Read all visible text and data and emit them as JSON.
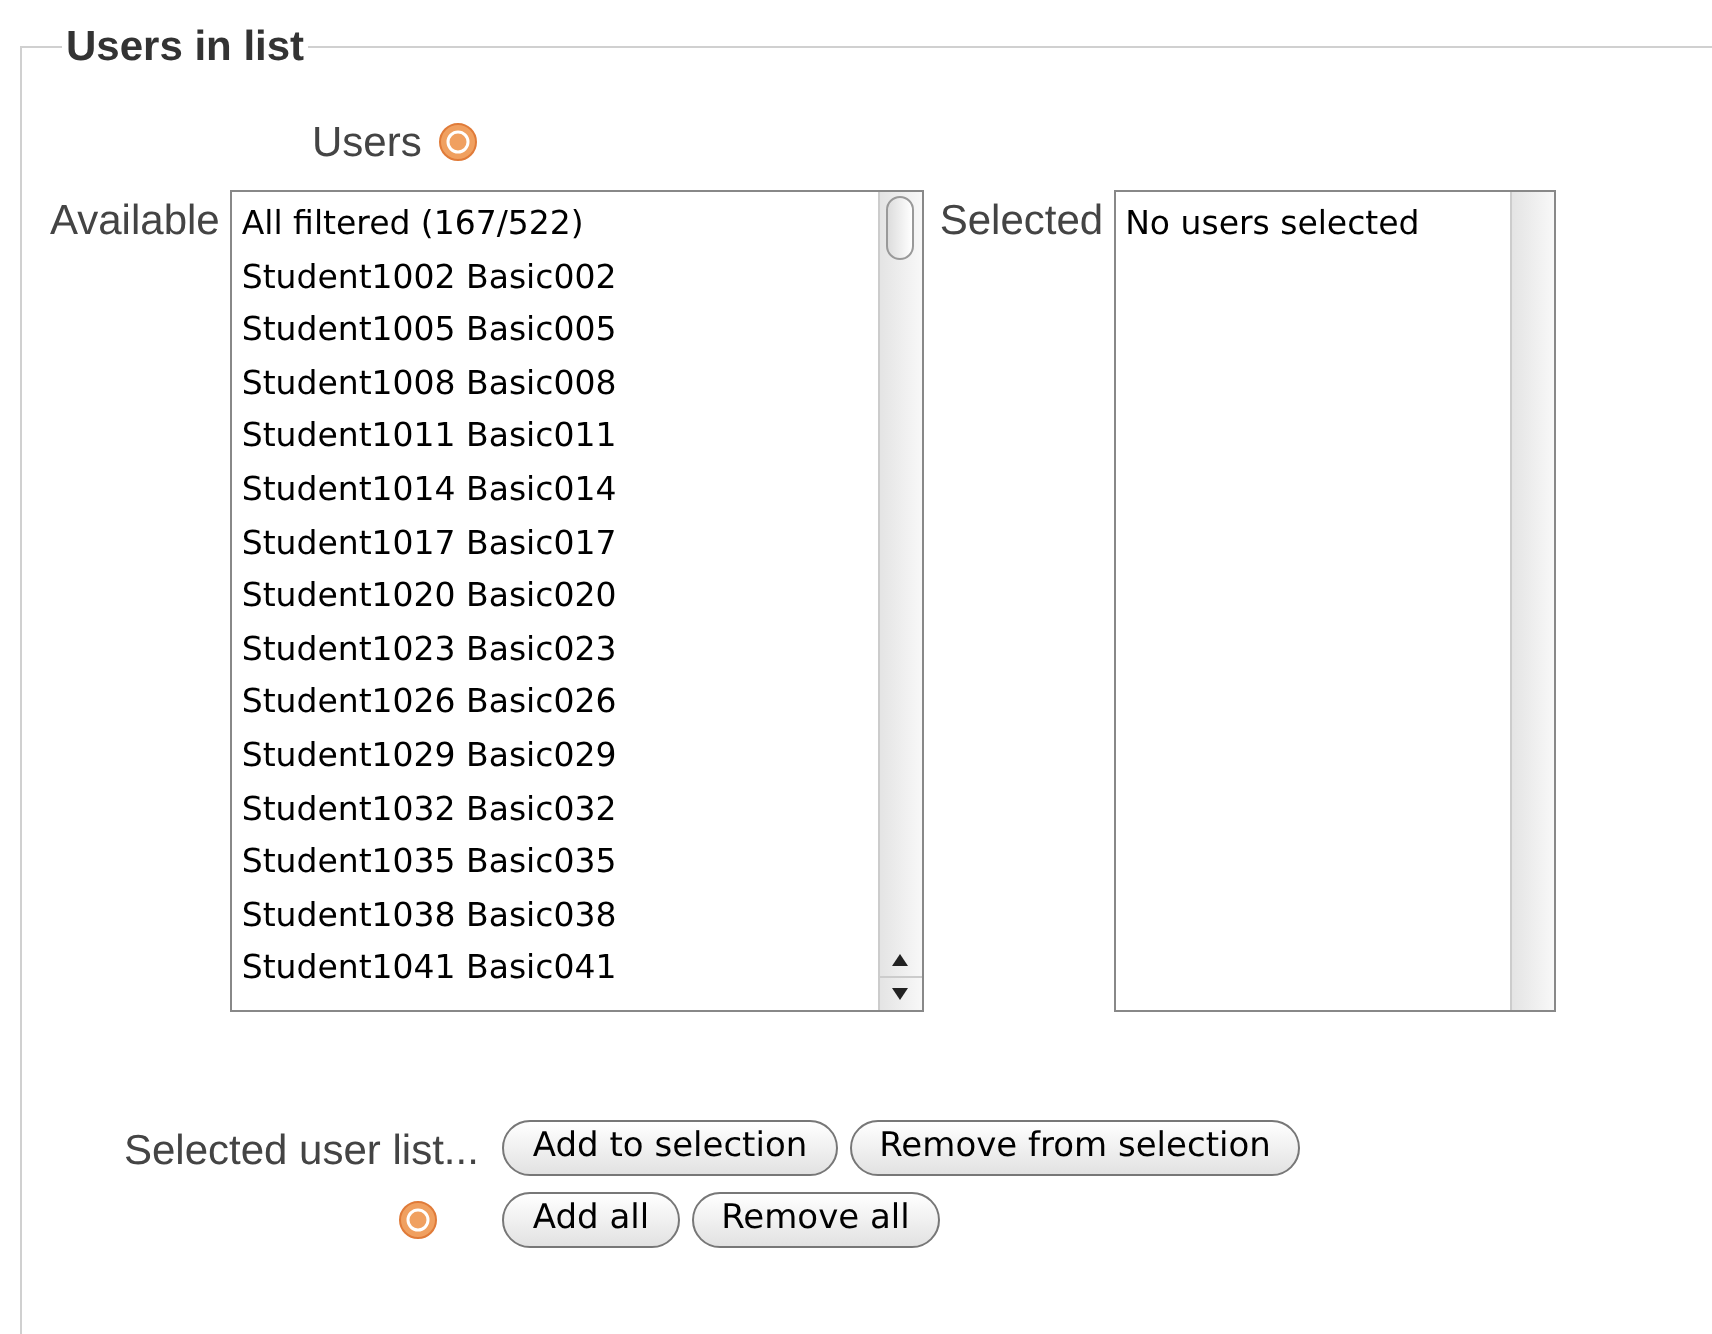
{
  "fieldset": {
    "legend": "Users in list"
  },
  "users_label": "Users",
  "available": {
    "label": "Available",
    "items": [
      "All filtered (167/522)",
      "Student1002 Basic002",
      "Student1005 Basic005",
      "Student1008 Basic008",
      "Student1011 Basic011",
      "Student1014 Basic014",
      "Student1017 Basic017",
      "Student1020 Basic020",
      "Student1023 Basic023",
      "Student1026 Basic026",
      "Student1029 Basic029",
      "Student1032 Basic032",
      "Student1035 Basic035",
      "Student1038 Basic038",
      "Student1041 Basic041"
    ]
  },
  "selected": {
    "label": "Selected",
    "items": [
      "No users selected"
    ]
  },
  "actions": {
    "label": "Selected user list...",
    "buttons": [
      [
        "Add to selection",
        "Remove from selection"
      ],
      [
        "Add all",
        "Remove all"
      ]
    ]
  }
}
